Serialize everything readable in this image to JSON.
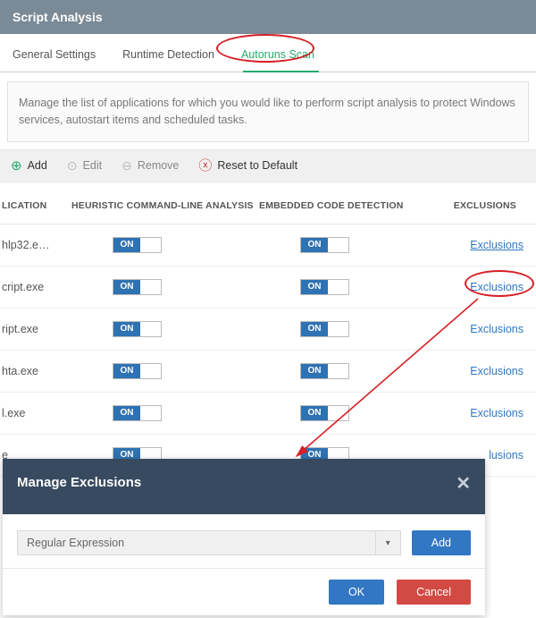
{
  "header": {
    "title": "Script Analysis"
  },
  "tabs": {
    "items": [
      {
        "label": "General Settings"
      },
      {
        "label": "Runtime Detection"
      },
      {
        "label": "Autoruns Scan"
      }
    ],
    "active_index": 2
  },
  "description": "Manage the list of applications for which you would like to perform script analysis to protect Windows services, autostart items and scheduled tasks.",
  "actions": {
    "add": {
      "label": "Add"
    },
    "edit": {
      "label": "Edit"
    },
    "remove": {
      "label": "Remove"
    },
    "reset": {
      "label": "Reset to Default"
    }
  },
  "columns": {
    "app": "LICATION",
    "heur": "HEURISTIC COMMAND-LINE ANALYSIS",
    "emb": "EMBEDDED CODE DETECTION",
    "ex": "EXCLUSIONS"
  },
  "toggle_label": "ON",
  "rows": [
    {
      "app": "hlp32.e…",
      "heur": "ON",
      "emb": "ON",
      "ex": "Exclusions"
    },
    {
      "app": "cript.exe",
      "heur": "ON",
      "emb": "ON",
      "ex": "Exclusions"
    },
    {
      "app": "ript.exe",
      "heur": "ON",
      "emb": "ON",
      "ex": "Exclusions"
    },
    {
      "app": "hta.exe",
      "heur": "ON",
      "emb": "ON",
      "ex": "Exclusions"
    },
    {
      "app": "l.exe",
      "heur": "ON",
      "emb": "ON",
      "ex": "Exclusions"
    },
    {
      "app": "e",
      "heur": "ON",
      "emb": "ON",
      "ex": "lusions"
    }
  ],
  "dialog": {
    "title": "Manage Exclusions",
    "select_value": "Regular Expression",
    "add_label": "Add",
    "ok_label": "OK",
    "cancel_label": "Cancel"
  }
}
